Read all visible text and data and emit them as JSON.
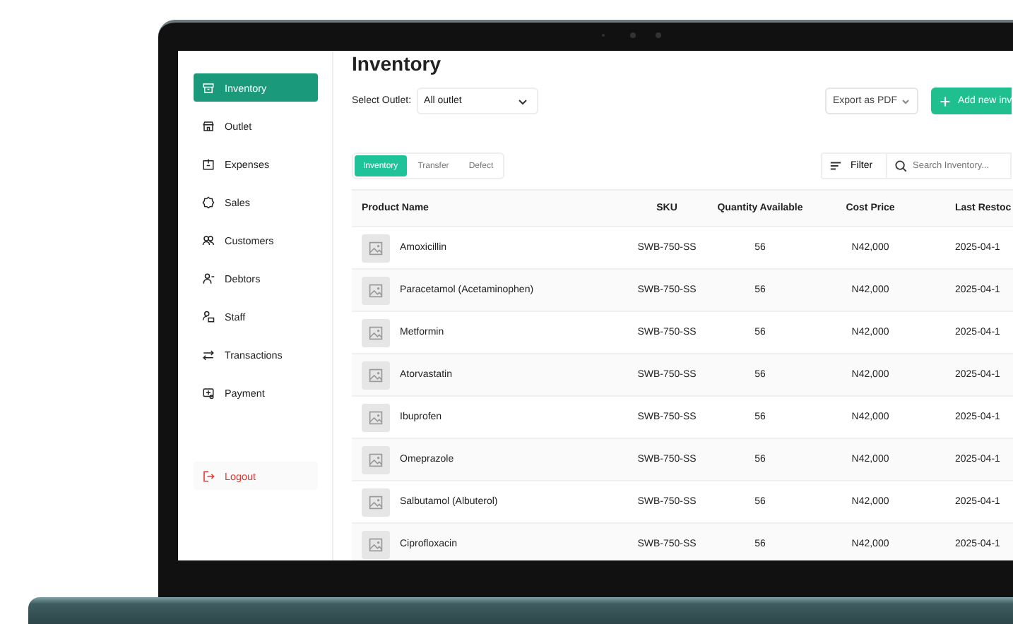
{
  "page_title": "Inventory",
  "sidebar": {
    "items": [
      {
        "label": "Inventory",
        "selected": true
      },
      {
        "label": "Outlet",
        "selected": false
      },
      {
        "label": "Expenses",
        "selected": false
      },
      {
        "label": "Sales",
        "selected": false
      },
      {
        "label": "Customers",
        "selected": false
      },
      {
        "label": "Debtors",
        "selected": false
      },
      {
        "label": "Staff",
        "selected": false
      },
      {
        "label": "Transactions",
        "selected": false
      },
      {
        "label": "Payment",
        "selected": false
      }
    ],
    "logout": {
      "label": "Logout"
    }
  },
  "outlet_select": {
    "label": "Select Outlet:",
    "value": "All outlet"
  },
  "export_button": "Export as PDF",
  "add_button": "Add new inv",
  "tabs": [
    {
      "label": "Inventory",
      "selected": true
    },
    {
      "label": "Transfer",
      "selected": false
    },
    {
      "label": "Defect",
      "selected": false
    }
  ],
  "filter_button": "Filter",
  "search": {
    "placeholder": "Search Inventory..."
  },
  "table": {
    "columns": [
      "Product Name",
      "SKU",
      "Quantity Available",
      "Cost Price",
      "Last Restoc"
    ],
    "rows": [
      {
        "product": "Amoxicillin",
        "sku": "SWB-750-SS",
        "quantity": "56",
        "cost": "N42,000",
        "last_restock": "2025-04-1"
      },
      {
        "product": "Paracetamol (Acetaminophen)",
        "sku": "SWB-750-SS",
        "quantity": "56",
        "cost": "N42,000",
        "last_restock": "2025-04-1"
      },
      {
        "product": "Metformin",
        "sku": "SWB-750-SS",
        "quantity": "56",
        "cost": "N42,000",
        "last_restock": "2025-04-1"
      },
      {
        "product": "Atorvastatin",
        "sku": "SWB-750-SS",
        "quantity": "56",
        "cost": "N42,000",
        "last_restock": "2025-04-1"
      },
      {
        "product": "Ibuprofen",
        "sku": "SWB-750-SS",
        "quantity": "56",
        "cost": "N42,000",
        "last_restock": "2025-04-1"
      },
      {
        "product": "Omeprazole",
        "sku": "SWB-750-SS",
        "quantity": "56",
        "cost": "N42,000",
        "last_restock": "2025-04-1"
      },
      {
        "product": "Salbutamol (Albuterol)",
        "sku": "SWB-750-SS",
        "quantity": "56",
        "cost": "N42,000",
        "last_restock": "2025-04-1"
      },
      {
        "product": "Ciprofloxacin",
        "sku": "SWB-750-SS",
        "quantity": "56",
        "cost": "N42,000",
        "last_restock": "2025-04-1"
      }
    ]
  }
}
